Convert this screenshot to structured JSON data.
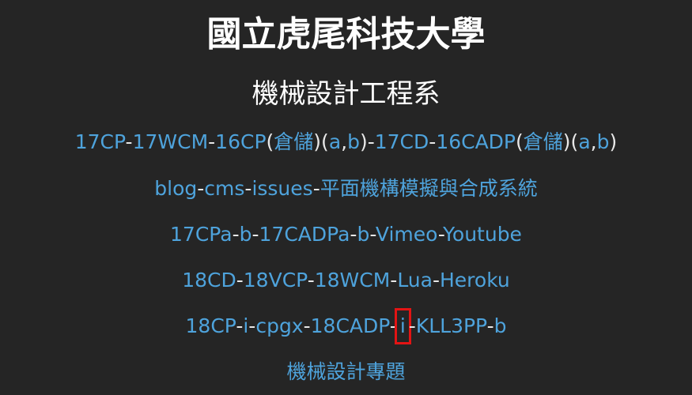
{
  "header": {
    "title": "國立虎尾科技大學",
    "subtitle": "機械設計工程系"
  },
  "rows": [
    {
      "items": [
        "17CP",
        "-",
        "17WCM",
        "-",
        "16CP",
        "(",
        "倉儲",
        ")(",
        "a",
        ",",
        "b",
        ")-",
        "17CD",
        "-",
        "16CADP",
        "(",
        "倉儲",
        ")(",
        "a",
        ",",
        "b",
        ")"
      ]
    },
    {
      "items": [
        "blog",
        "-",
        "cms",
        "-",
        "issues",
        "-",
        "平面機構模擬與合成系統"
      ]
    },
    {
      "items": [
        "17CPa",
        "-",
        "b",
        "-",
        "17CADPa",
        "-",
        "b",
        "-",
        "Vimeo",
        "-",
        "Youtube"
      ]
    },
    {
      "items": [
        "18CD",
        "-",
        "18VCP",
        "-",
        "18WCM",
        "-",
        "Lua",
        "-",
        "Heroku"
      ]
    },
    {
      "items": [
        "18CP",
        "-",
        "i",
        "-",
        "cpgx",
        "-",
        "18CADP",
        "-",
        "i",
        "-",
        "KLL3PP",
        "-",
        "b"
      ]
    },
    {
      "items": [
        "機械設計專題"
      ]
    }
  ],
  "colors": {
    "background": "#252525",
    "link": "#4ea3dc",
    "separator": "#e8e8e8",
    "highlight": "#e31414"
  }
}
